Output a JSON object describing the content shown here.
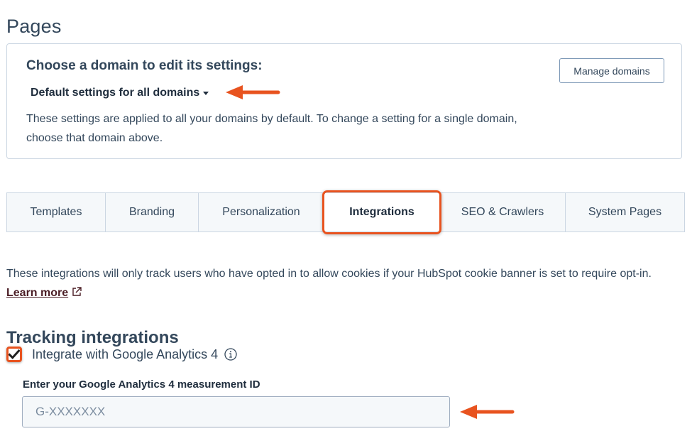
{
  "page": {
    "title": "Pages"
  },
  "domain_card": {
    "heading": "Choose a domain to edit its settings:",
    "selected_domain": "Default settings for all domains",
    "description": "These settings are applied to all your domains by default. To change a setting for a single domain, choose that domain above.",
    "manage_button": "Manage domains"
  },
  "tabs": [
    {
      "label": "Templates",
      "active": false
    },
    {
      "label": "Branding",
      "active": false
    },
    {
      "label": "Personalization",
      "active": false
    },
    {
      "label": "Integrations",
      "active": true
    },
    {
      "label": "SEO & Crawlers",
      "active": false
    },
    {
      "label": "System Pages",
      "active": false
    }
  ],
  "integrations": {
    "intro_text": "These integrations will only track users who have opted in to allow cookies if your HubSpot cookie banner is set to require opt-in.",
    "learn_more": "Learn more",
    "section_title": "Tracking integrations",
    "ga4": {
      "checkbox_label": "Integrate with Google Analytics 4",
      "checked": true,
      "field_label": "Enter your Google Analytics 4 measurement ID",
      "placeholder": "G-XXXXXXX",
      "value": ""
    }
  },
  "icons": {
    "caret": "caret-down-icon",
    "external": "external-link-icon",
    "info": "info-icon",
    "check": "checkmark-icon",
    "annotation": "arrow-left-icon"
  },
  "colors": {
    "accent": "#e8531f",
    "text": "#33475b",
    "link": "#4a1c24",
    "border": "#cbd6e2"
  }
}
